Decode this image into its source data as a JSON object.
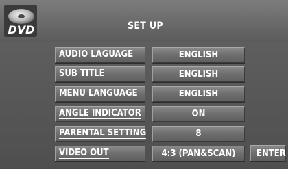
{
  "header": {
    "title": "SET UP",
    "logo_text": "DVD"
  },
  "settings": [
    {
      "label": "AUDIO LAGUAGE",
      "value": "ENGLISH"
    },
    {
      "label": "SUB TITLE",
      "value": "ENGLISH"
    },
    {
      "label": "MENU LANGUAGE",
      "value": "ENGLISH"
    },
    {
      "label": "ANGLE INDICATOR",
      "value": "ON"
    },
    {
      "label": "PARENTAL SETTING",
      "value": "8"
    },
    {
      "label": "VIDEO OUT",
      "value": "4:3 (PAN&SCAN)"
    }
  ],
  "enter_label": "ENTER"
}
